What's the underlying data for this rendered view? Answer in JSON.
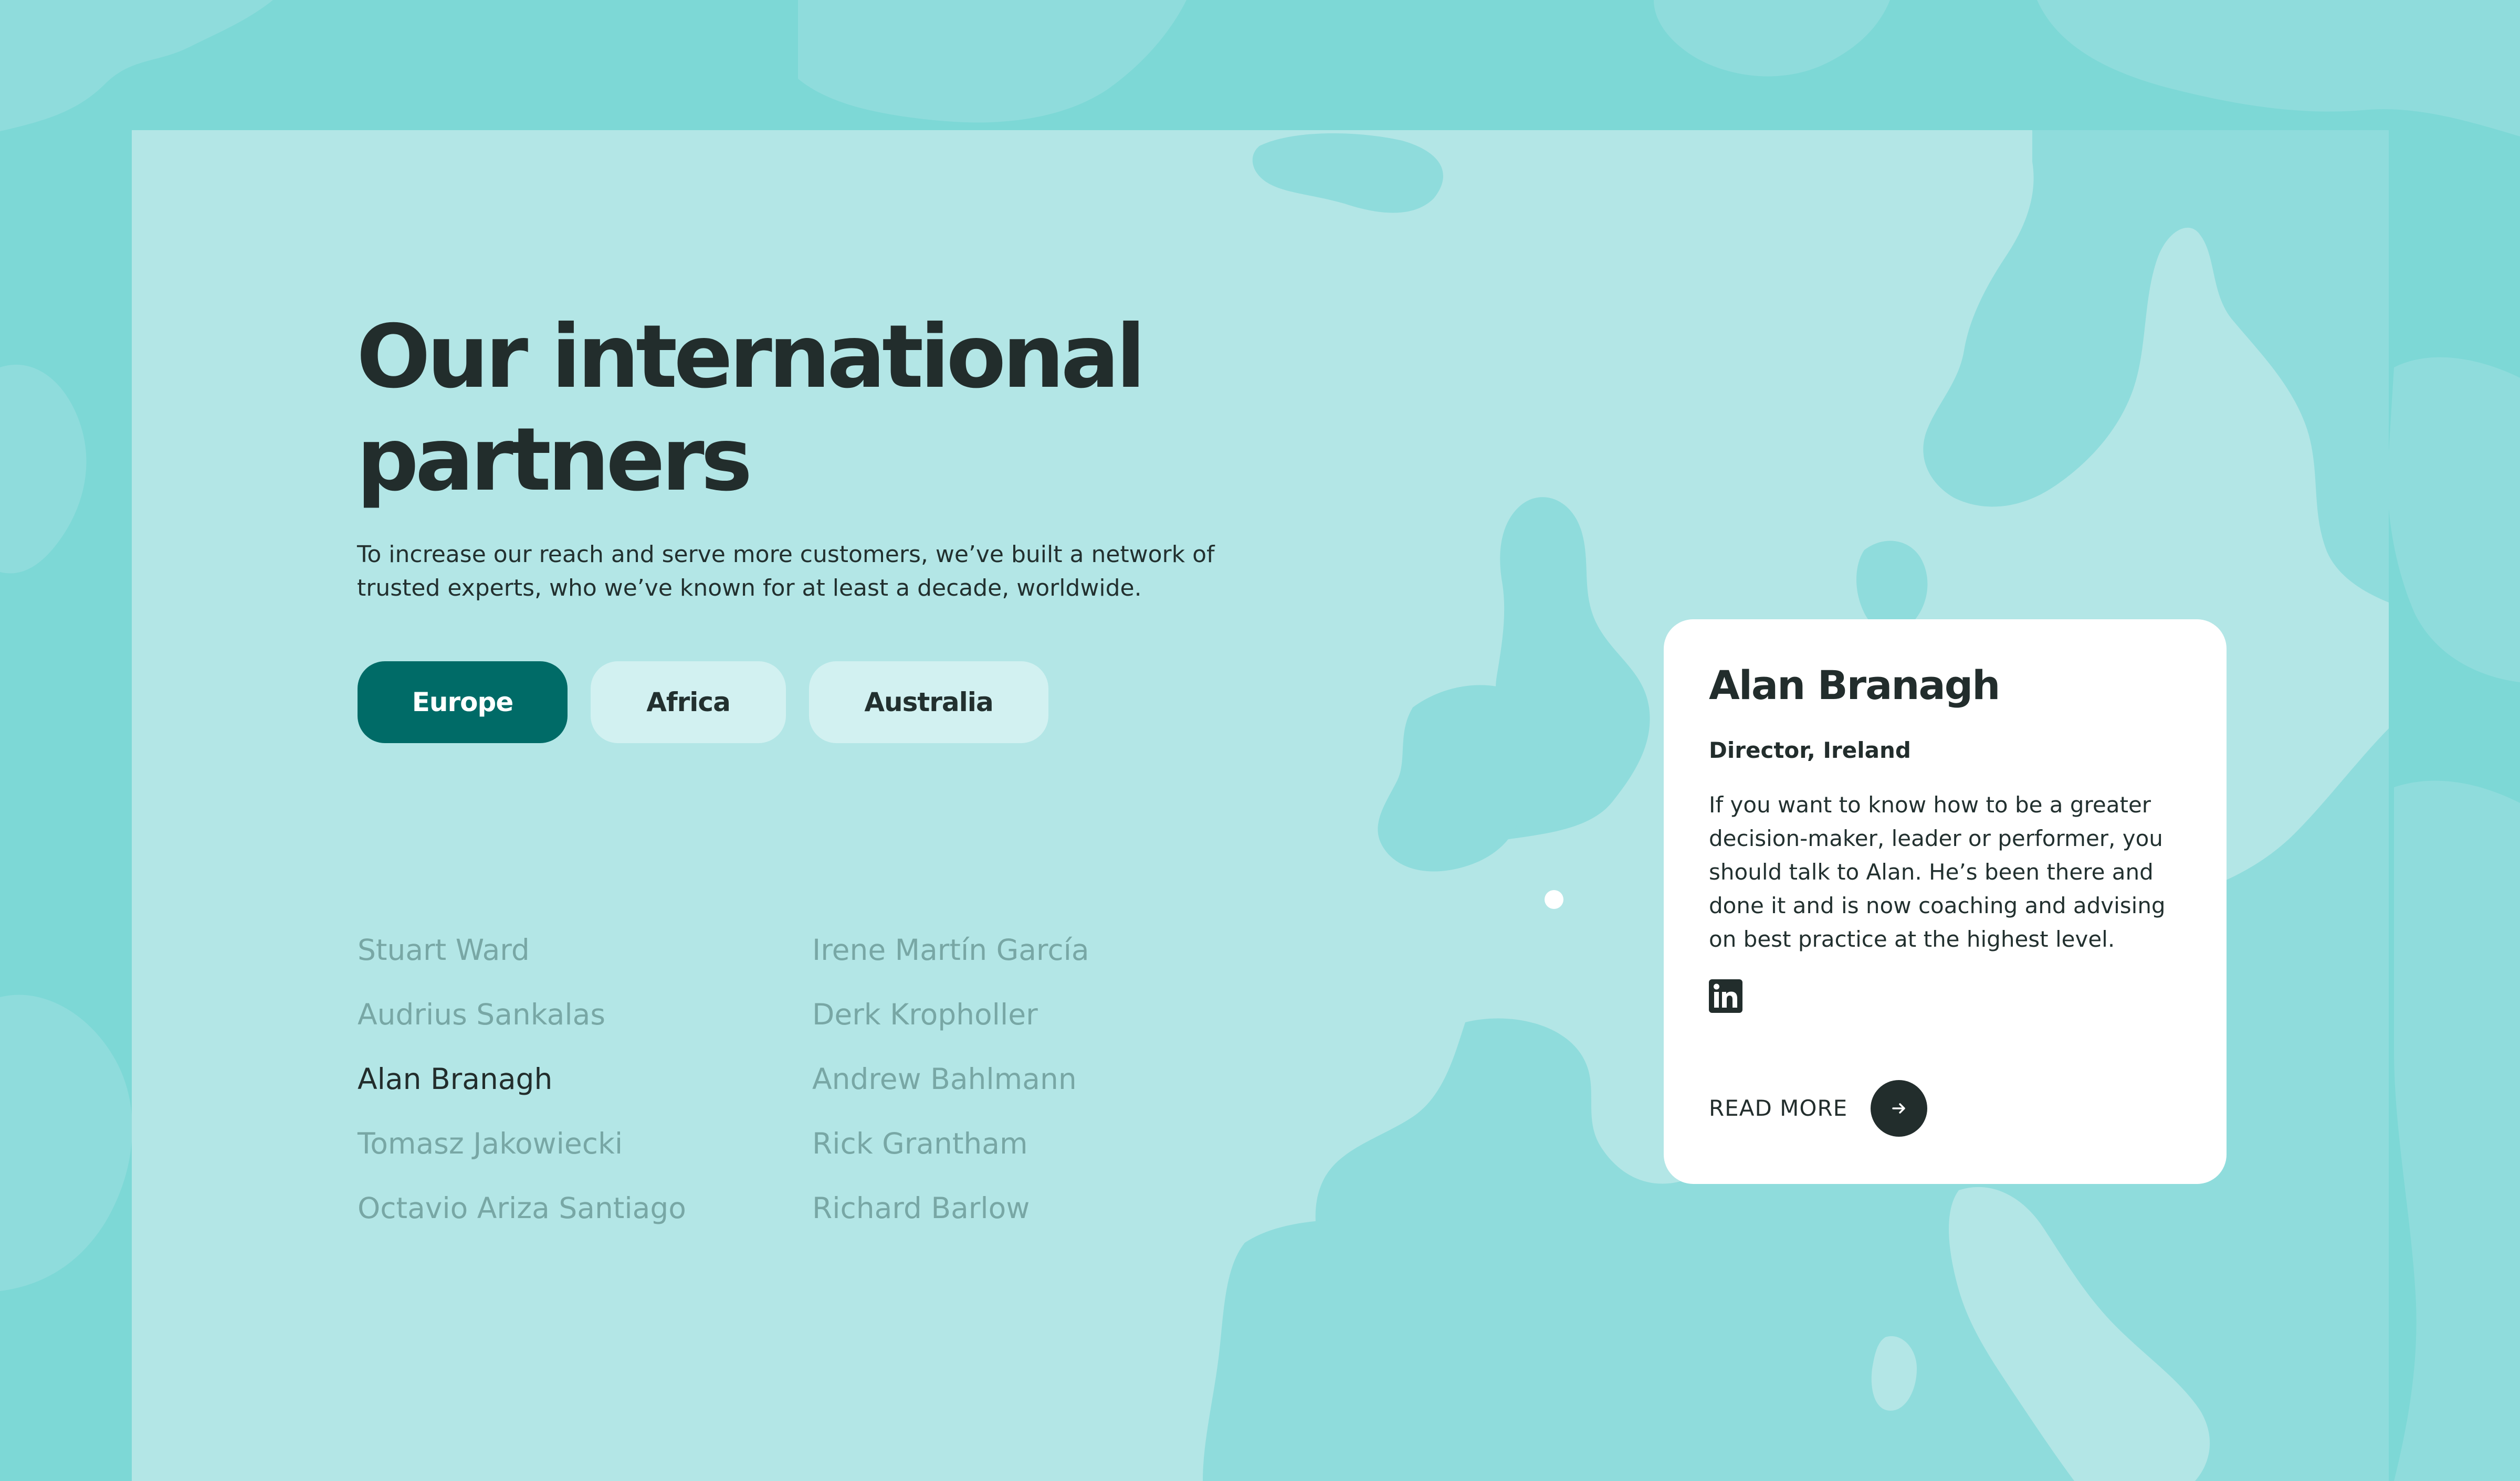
{
  "heading": "Our international partners",
  "intro": "To increase our reach and serve more customers, we’ve built a network of trusted experts, who we’ve known for at least a decade, worldwide.",
  "tabs": [
    {
      "label": "Europe",
      "active": true
    },
    {
      "label": "Africa",
      "active": false
    },
    {
      "label": "Australia",
      "active": false
    }
  ],
  "partners": {
    "column1": [
      "Stuart Ward",
      "Audrius Sankalas",
      "Alan Branagh",
      "Tomasz Jakowiecki",
      "Octavio Ariza Santiago"
    ],
    "column2": [
      "Irene Martín García",
      "Derk Kropholler",
      "Andrew Bahlmann",
      "Rick Grantham",
      "Richard Barlow"
    ],
    "selected": "Alan Branagh"
  },
  "card": {
    "name": "Alan Branagh",
    "role": "Director, Ireland",
    "bio": "If you want to know how to be a greater decision-maker, leader or performer, you should talk to Alan. He’s been there and done it and is now coaching and advising on best practice at the highest level.",
    "social_icon": "linkedin-icon",
    "read_more": "READ MORE"
  },
  "colors": {
    "outer_background": "#7dd8d6",
    "panel_background": "#b3e6e6",
    "land": "#8fdcdc",
    "accent": "#006b67",
    "inactive_tab": "#d2f1f1",
    "text_dark": "#222d2c",
    "text_muted": "#78a7a5"
  }
}
